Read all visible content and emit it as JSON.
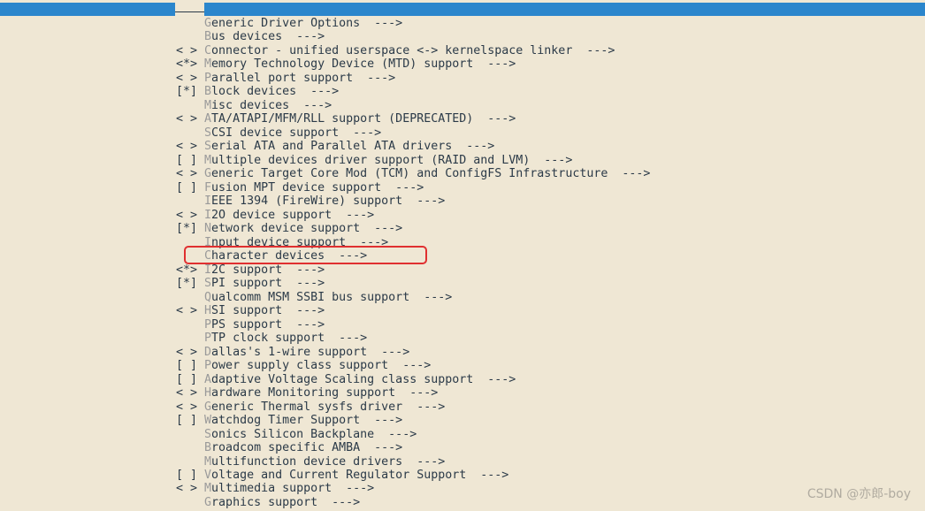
{
  "colors": {
    "background": "#efe7d4",
    "title_bar": "#2b86cc",
    "highlight_box": "#e03030",
    "text": "#2b3a48",
    "hotkey": "#9a9a9a"
  },
  "items": [
    {
      "prefix": "    ",
      "hotkey": "G",
      "label": "eneric Driver Options  --->"
    },
    {
      "prefix": "    ",
      "hotkey": "B",
      "label": "us devices  --->"
    },
    {
      "prefix": "< > ",
      "hotkey": "C",
      "label": "onnector - unified userspace <-> kernelspace linker  --->"
    },
    {
      "prefix": "<*> ",
      "hotkey": "M",
      "label": "emory Technology Device (MTD) support  --->"
    },
    {
      "prefix": "< > ",
      "hotkey": "P",
      "label": "arallel port support  --->"
    },
    {
      "prefix": "[*] ",
      "hotkey": "B",
      "label": "lock devices  --->"
    },
    {
      "prefix": "    ",
      "hotkey": "M",
      "label": "isc devices  --->"
    },
    {
      "prefix": "< > ",
      "hotkey": "A",
      "label": "TA/ATAPI/MFM/RLL support (DEPRECATED)  --->"
    },
    {
      "prefix": "    ",
      "hotkey": "S",
      "label": "CSI device support  --->"
    },
    {
      "prefix": "< > ",
      "hotkey": "S",
      "label": "erial ATA and Parallel ATA drivers  --->"
    },
    {
      "prefix": "[ ] ",
      "hotkey": "M",
      "label": "ultiple devices driver support (RAID and LVM)  --->"
    },
    {
      "prefix": "< > ",
      "hotkey": "G",
      "label": "eneric Target Core Mod (TCM) and ConfigFS Infrastructure  --->"
    },
    {
      "prefix": "[ ] ",
      "hotkey": "F",
      "label": "usion MPT device support  --->"
    },
    {
      "prefix": "    ",
      "hotkey": "I",
      "label": "EEE 1394 (FireWire) support  --->"
    },
    {
      "prefix": "< > ",
      "hotkey": "I",
      "label": "2O device support  --->"
    },
    {
      "prefix": "[*] ",
      "hotkey": "N",
      "label": "etwork device support  --->"
    },
    {
      "prefix": "    ",
      "hotkey": "I",
      "label": "nput device support  --->"
    },
    {
      "prefix": "    ",
      "hotkey": "C",
      "label": "haracter devices  --->"
    },
    {
      "prefix": "<*> ",
      "hotkey": "I",
      "label": "2C support  --->"
    },
    {
      "prefix": "[*] ",
      "hotkey": "S",
      "label": "PI support  --->"
    },
    {
      "prefix": "    ",
      "hotkey": "Q",
      "label": "ualcomm MSM SSBI bus support  --->"
    },
    {
      "prefix": "< > ",
      "hotkey": "H",
      "label": "SI support  --->"
    },
    {
      "prefix": "    ",
      "hotkey": "P",
      "label": "PS support  --->"
    },
    {
      "prefix": "    ",
      "hotkey": "P",
      "label": "TP clock support  --->"
    },
    {
      "prefix": "< > ",
      "hotkey": "D",
      "label": "allas's 1-wire support  --->"
    },
    {
      "prefix": "[ ] ",
      "hotkey": "P",
      "label": "ower supply class support  --->"
    },
    {
      "prefix": "[ ] ",
      "hotkey": "A",
      "label": "daptive Voltage Scaling class support  --->"
    },
    {
      "prefix": "< > ",
      "hotkey": "H",
      "label": "ardware Monitoring support  --->"
    },
    {
      "prefix": "< > ",
      "hotkey": "G",
      "label": "eneric Thermal sysfs driver  --->"
    },
    {
      "prefix": "[ ] ",
      "hotkey": "W",
      "label": "atchdog Timer Support  --->"
    },
    {
      "prefix": "    ",
      "hotkey": "S",
      "label": "onics Silicon Backplane  --->"
    },
    {
      "prefix": "    ",
      "hotkey": "B",
      "label": "roadcom specific AMBA  --->"
    },
    {
      "prefix": "    ",
      "hotkey": "M",
      "label": "ultifunction device drivers  --->"
    },
    {
      "prefix": "[ ] ",
      "hotkey": "V",
      "label": "oltage and Current Regulator Support  --->"
    },
    {
      "prefix": "< > ",
      "hotkey": "M",
      "label": "ultimedia support  --->"
    },
    {
      "prefix": "    ",
      "hotkey": "G",
      "label": "raphics support  --->"
    }
  ],
  "watermark": "CSDN @亦郎-boy"
}
